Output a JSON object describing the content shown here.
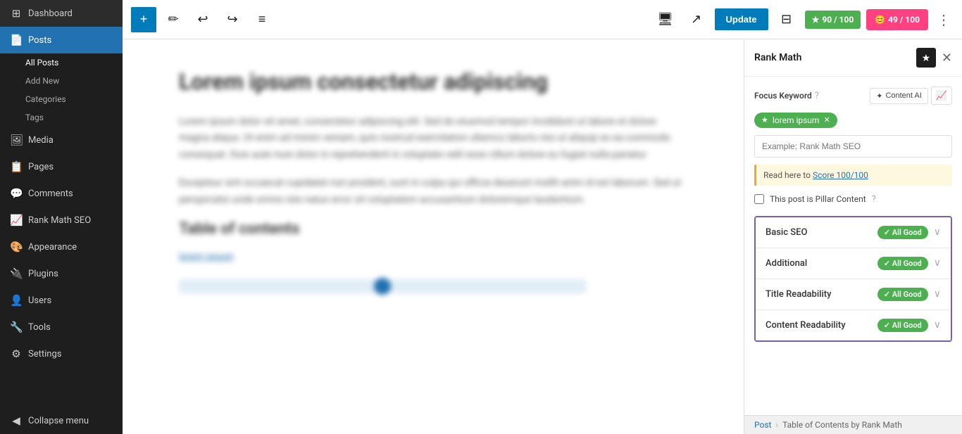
{
  "sidebar": {
    "items": [
      {
        "id": "dashboard",
        "label": "Dashboard",
        "icon": "⊞",
        "active": false
      },
      {
        "id": "posts",
        "label": "Posts",
        "icon": "📄",
        "active": true,
        "subitems": [
          {
            "id": "all-posts",
            "label": "All Posts",
            "active": true
          },
          {
            "id": "add-new",
            "label": "Add New",
            "active": false
          },
          {
            "id": "categories",
            "label": "Categories",
            "active": false
          },
          {
            "id": "tags",
            "label": "Tags",
            "active": false
          }
        ]
      },
      {
        "id": "media",
        "label": "Media",
        "icon": "🖼",
        "active": false
      },
      {
        "id": "pages",
        "label": "Pages",
        "icon": "📋",
        "active": false
      },
      {
        "id": "comments",
        "label": "Comments",
        "icon": "💬",
        "active": false
      },
      {
        "id": "rankmath",
        "label": "Rank Math SEO",
        "icon": "📈",
        "active": false
      },
      {
        "id": "appearance",
        "label": "Appearance",
        "icon": "🎨",
        "active": false
      },
      {
        "id": "plugins",
        "label": "Plugins",
        "icon": "🔌",
        "active": false
      },
      {
        "id": "users",
        "label": "Users",
        "icon": "👤",
        "active": false
      },
      {
        "id": "tools",
        "label": "Tools",
        "icon": "🔧",
        "active": false
      },
      {
        "id": "settings",
        "label": "Settings",
        "icon": "⚙",
        "active": false
      },
      {
        "id": "collapse",
        "label": "Collapse menu",
        "icon": "◀",
        "active": false
      }
    ]
  },
  "toolbar": {
    "add_label": "+",
    "pencil_label": "✏",
    "undo_label": "↩",
    "redo_label": "↪",
    "list_label": "≡",
    "monitor_label": "🖥",
    "external_label": "↗",
    "update_label": "Update",
    "panel_label": "⊟",
    "score_green_label": "90 / 100",
    "score_pink_label": "49 / 100",
    "more_label": "⋮"
  },
  "editor": {
    "title": "Lorem ipsum consectetur adipiscing",
    "para1": "Lorem ipsum dolor sit amet, consectetur adipiscing elit. Sed do eiusmod tempor incididunt ut labore et dolore magna aliqua. Ut enim ad minim veniam, quis nostrud exercitation ullamco laboris nisi ut aliquip ex ea commodo consequat. Duis aute irure dolor in reprehenderit in voluptate velit esse cillum dolore eu fugiat nulla pariatur.",
    "para2": "Excepteur sint occaecat cupidatat non proident, sunt in culpa qui officia deserunt mollit anim id est laborum. Sed ut perspiciatis unde omnis iste natus error sit voluptatem accusantium doloremque laudantium.",
    "section_title": "Table of contents",
    "link_text": "lorem ipsum"
  },
  "rankmath": {
    "title": "Rank Math",
    "focus_keyword_label": "Focus Keyword",
    "help_icon": "?",
    "content_ai_label": "Content AI",
    "keyword_tag": "lorem ipsum",
    "keyword_input_placeholder": "Example: Rank Math SEO",
    "notice_text": "Read here to",
    "notice_link": "Score 100/100",
    "pillar_label": "This post is Pillar Content",
    "accordion": [
      {
        "id": "basic-seo",
        "label": "Basic SEO",
        "badge": "✓ All Good",
        "expanded": false
      },
      {
        "id": "additional",
        "label": "Additional",
        "badge": "✓ All Good",
        "expanded": false
      },
      {
        "id": "title-readability",
        "label": "Title Readability",
        "badge": "✓ All Good",
        "expanded": false
      },
      {
        "id": "content-readability",
        "label": "Content Readability",
        "badge": "✓ All Good",
        "expanded": false
      }
    ]
  },
  "breadcrumb": {
    "parent": "Post",
    "separator": "›",
    "current": "Table of Contents by Rank Math"
  }
}
